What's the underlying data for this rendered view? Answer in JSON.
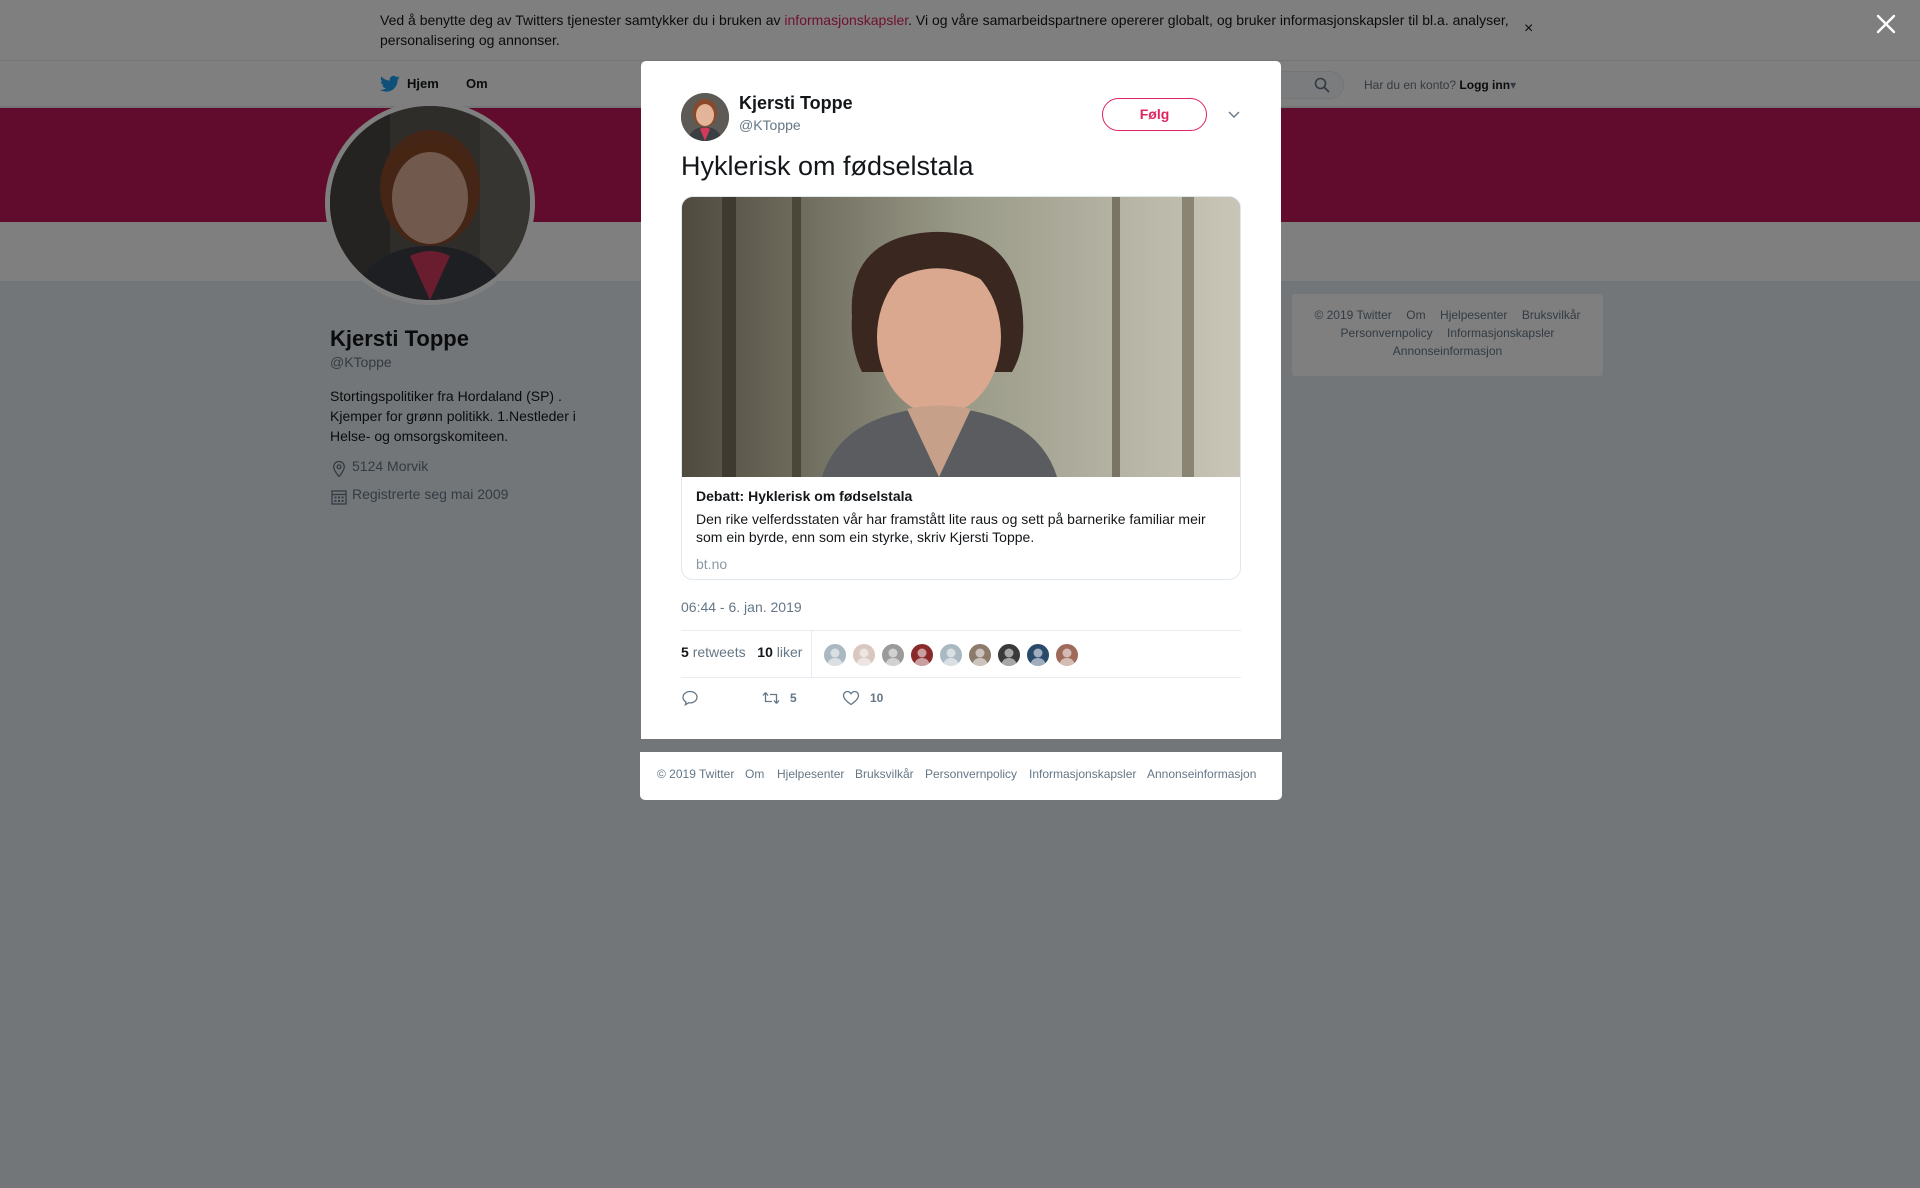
{
  "cookie": {
    "text_before": "Ved å benytte deg av Twitters tjenester samtykker du i bruken av ",
    "link": "informasjonskapsler",
    "text_after": ". Vi og våre samarbeidspartnere opererer globalt, og bruker informasjonskapsler til bl.a. analyser, personalisering og annonser.",
    "close": "×"
  },
  "nav": {
    "home": "Hjem",
    "about": "Om",
    "login_prompt": "Har du en konto?",
    "login_link": "Logg inn",
    "login_caret": "▾"
  },
  "profile": {
    "name": "Kjersti Toppe",
    "handle": "@KToppe",
    "bio": "Stortingspolitiker fra Hordaland (SP) . Kjemper for grønn politikk. 1.Nestleder i Helse- og omsorgskomiteen.",
    "location": "5124 Morvik",
    "joined": "Registrerte seg mai 2009"
  },
  "side_footer": {
    "links": [
      "© 2019 Twitter",
      "Om",
      "Hjelpesenter",
      "Bruksvilkår",
      "Personvernpolicy",
      "Informasjonskapsler",
      "Annonseinformasjon"
    ]
  },
  "tweet": {
    "author_name": "Kjersti Toppe",
    "author_handle": "@KToppe",
    "follow_label": "Følg",
    "text": "Hyklerisk om fødselstala",
    "card": {
      "title": "Debatt: Hyklerisk om fødselstala",
      "description": "Den rike velferdsstaten vår har framstått lite raus og sett på barnerike familiar meir som ein byrde, enn som ein styrke, skriv Kjersti Toppe.",
      "domain": "bt.no"
    },
    "timestamp": "06:44 - 6. jan. 2019",
    "retweets_count": "5",
    "retweets_label": "retweets",
    "likes_count": "10",
    "likes_label": "liker",
    "reply_count": "",
    "retweet_action_count": "5",
    "like_action_count": "10",
    "liker_faces": 9
  },
  "modal_footer": {
    "links": [
      "© 2019 Twitter",
      "Om",
      "Hjelpesenter",
      "Bruksvilkår",
      "Personvernpolicy",
      "Informasjonskapsler",
      "Annonseinformasjon"
    ]
  },
  "colors": {
    "accent": "#e0245e",
    "banner": "#c2185b",
    "twitter_blue": "#1da1f2",
    "secondary_text": "#657786"
  },
  "icons": [
    "twitter-bird-icon",
    "search-icon",
    "location-icon",
    "calendar-icon",
    "chevron-down-icon",
    "reply-icon",
    "retweet-icon",
    "heart-icon",
    "close-icon"
  ]
}
